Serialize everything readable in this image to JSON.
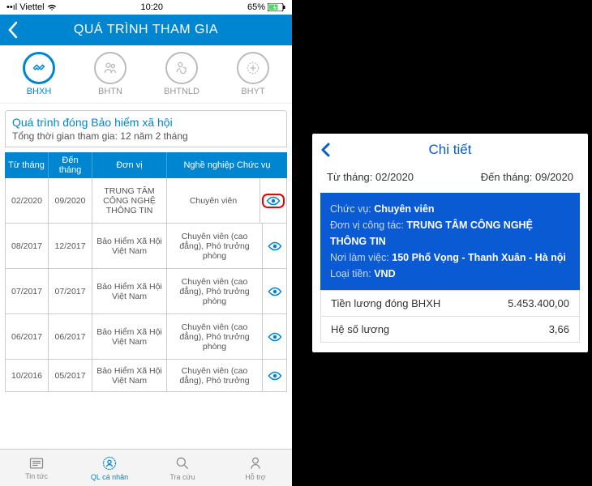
{
  "status": {
    "carrier": "Viettel",
    "time": "10:20",
    "battery": "65%"
  },
  "nav": {
    "title": "QUÁ TRÌNH THAM GIA"
  },
  "tabs": [
    {
      "key": "bhxh",
      "label": "BHXH",
      "active": true
    },
    {
      "key": "bhtn",
      "label": "BHTN",
      "active": false
    },
    {
      "key": "bhtnld",
      "label": "BHTNLD",
      "active": false
    },
    {
      "key": "bhyt",
      "label": "BHYT",
      "active": false
    }
  ],
  "summary": {
    "title": "Quá trình đóng Bảo hiểm xã hội",
    "sub_prefix": "Tổng thời gian tham gia: ",
    "sub_value": "12 năm 2 tháng"
  },
  "table": {
    "headers": {
      "from": "Từ tháng",
      "to": "Đến tháng",
      "unit": "Đơn vị",
      "job": "Nghề nghiệp Chức vụ"
    },
    "rows": [
      {
        "from": "02/2020",
        "to": "09/2020",
        "unit": "TRUNG TÂM CÔNG NGHỆ THÔNG TIN",
        "job": "Chuyên viên",
        "highlight": true
      },
      {
        "from": "08/2017",
        "to": "12/2017",
        "unit": "Bảo Hiểm Xã Hội Việt Nam",
        "job": "Chuyên viên (cao đẳng), Phó trưởng phòng",
        "highlight": false
      },
      {
        "from": "07/2017",
        "to": "07/2017",
        "unit": "Bảo Hiểm Xã Hội Việt Nam",
        "job": "Chuyên viên (cao đẳng), Phó trưởng phòng",
        "highlight": false
      },
      {
        "from": "06/2017",
        "to": "06/2017",
        "unit": "Bảo Hiểm Xã Hội Việt Nam",
        "job": "Chuyên viên (cao đẳng), Phó trưởng phòng",
        "highlight": false
      },
      {
        "from": "10/2016",
        "to": "05/2017",
        "unit": "Bảo Hiểm Xã Hội Việt Nam",
        "job": "Chuyên viên (cao đẳng), Phó trưởng",
        "highlight": false
      }
    ]
  },
  "bottom": [
    {
      "label": "Tin tức"
    },
    {
      "label": "QL cá nhân"
    },
    {
      "label": "Tra cứu"
    },
    {
      "label": "Hỗ trợ"
    }
  ],
  "detail": {
    "title": "Chi tiết",
    "from_label": "Từ tháng:",
    "from_value": "02/2020",
    "to_label": "Đến tháng:",
    "to_value": "09/2020",
    "pos_label": "Chức vụ:",
    "pos_value": "Chuyên viên",
    "unit_label": "Đơn vị công tác:",
    "unit_value": "TRUNG TÂM CÔNG NGHỆ THÔNG TIN",
    "loc_label": "Nơi làm việc:",
    "loc_value": "150 Phố Vọng - Thanh Xuân - Hà nội",
    "cur_label": "Loại tiền:",
    "cur_value": "VND",
    "rows": [
      {
        "label": "Tiền lương đóng BHXH",
        "value": "5.453.400,00"
      },
      {
        "label": "Hệ số lương",
        "value": "3,66"
      }
    ]
  }
}
